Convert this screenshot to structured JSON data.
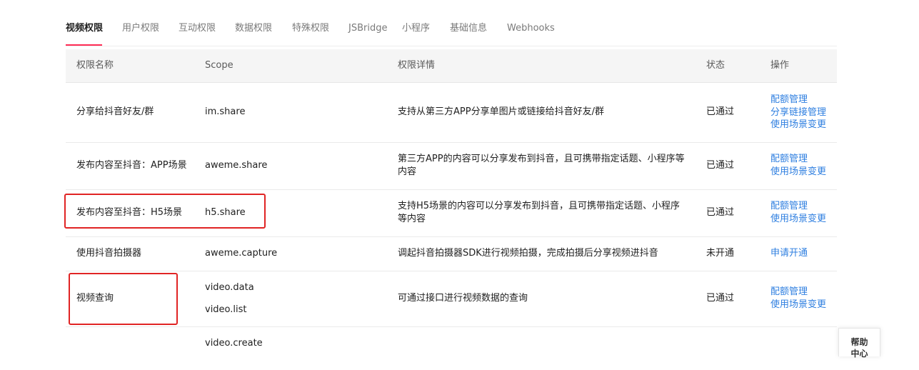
{
  "tabs": [
    {
      "label": "视频权限",
      "active": true
    },
    {
      "label": "用户权限"
    },
    {
      "label": "互动权限"
    },
    {
      "label": "数据权限"
    },
    {
      "label": "特殊权限"
    },
    {
      "label": "JSBridge"
    },
    {
      "label": "小程序"
    },
    {
      "label": "基础信息"
    },
    {
      "label": "Webhooks"
    }
  ],
  "table": {
    "headers": {
      "name": "权限名称",
      "scope": "Scope",
      "detail": "权限详情",
      "status": "状态",
      "ops": "操作"
    },
    "rows": [
      {
        "name": "分享给抖音好友/群",
        "scopes": [
          "im.share"
        ],
        "detail": "支持从第三方APP分享单图片或链接给抖音好友/群",
        "status": "已通过",
        "ops": [
          "配额管理",
          "分享链接管理",
          "使用场景变更"
        ]
      },
      {
        "name": "发布内容至抖音：APP场景",
        "scopes": [
          "aweme.share"
        ],
        "detail": "第三方APP的内容可以分享发布到抖音，且可携带指定话题、小程序等内容",
        "status": "已通过",
        "ops": [
          "配额管理",
          "使用场景变更"
        ]
      },
      {
        "name": "发布内容至抖音：H5场景",
        "scopes": [
          "h5.share"
        ],
        "detail": "支持H5场景的内容可以分享发布到抖音，且可携带指定话题、小程序等内容",
        "status": "已通过",
        "ops": [
          "配额管理",
          "使用场景变更"
        ]
      },
      {
        "name": "使用抖音拍摄器",
        "scopes": [
          "aweme.capture"
        ],
        "detail": "调起抖音拍摄器SDK进行视频拍摄，完成拍摄后分享视频进抖音",
        "status": "未开通",
        "ops": [
          "申请开通"
        ]
      },
      {
        "name": "视频查询",
        "scopes": [
          "video.data",
          "video.list"
        ],
        "detail": "可通过接口进行视频数据的查询",
        "status": "已通过",
        "ops": [
          "配额管理",
          "使用场景变更"
        ]
      },
      {
        "name": "",
        "scopes": [
          "video.create"
        ],
        "detail": "",
        "status": "",
        "ops": []
      }
    ]
  },
  "help_button": {
    "label_line1": "帮助",
    "label_line2": "中心"
  },
  "colors": {
    "accent": "#fe2c55",
    "link": "#2f7fe0",
    "highlight": "#e02424",
    "header_bg": "#f5f5f5"
  }
}
